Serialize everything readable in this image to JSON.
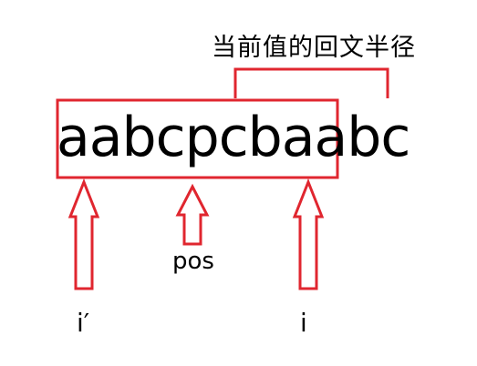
{
  "bracket_label": "当前值的回文半径",
  "string_text": "aabcpcbaabc",
  "pos_label": "pos",
  "i_prime_label": "i′",
  "i_label": "i",
  "colors": {
    "annotation": "#e0262f",
    "text": "#000000",
    "background": "#ffffff"
  },
  "icons": {
    "arrow": "up-arrow-outline-icon"
  }
}
